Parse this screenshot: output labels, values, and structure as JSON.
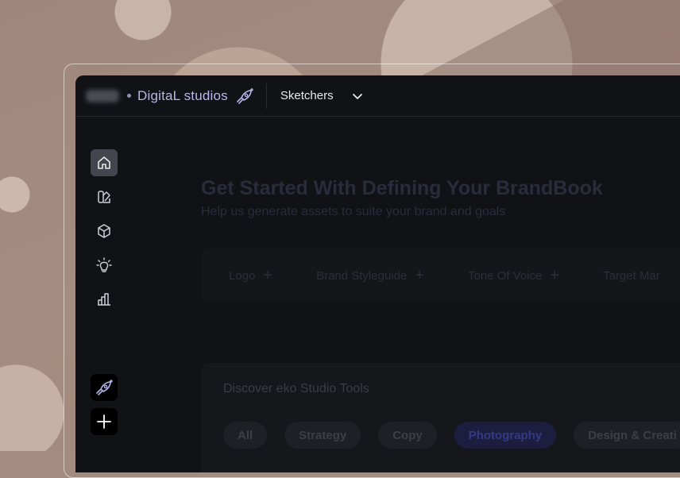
{
  "header": {
    "studio_name": "DigitaL studios",
    "workspace": "Sketchers"
  },
  "sidebar": {
    "items": [
      {
        "icon": "home-icon",
        "active": true
      },
      {
        "icon": "swatches-icon",
        "active": false
      },
      {
        "icon": "cube-icon",
        "active": false
      },
      {
        "icon": "lightbulb-icon",
        "active": false
      },
      {
        "icon": "bar-chart-icon",
        "active": false
      }
    ],
    "bottom": [
      {
        "icon": "rocket-icon"
      },
      {
        "icon": "plus-icon"
      }
    ]
  },
  "main": {
    "headline": "Get Started With Defining Your BrandBook",
    "subline": "Help us generate assets to suite your brand and goals",
    "assets": [
      {
        "label": "Logo"
      },
      {
        "label": "Brand Styleguide"
      },
      {
        "label": "Tone Of Voice"
      },
      {
        "label": "Target Mar"
      }
    ],
    "tools": {
      "title": "Discover eko Studio Tools",
      "chips": [
        "All",
        "Strategy",
        "Copy",
        "Photography",
        "Design & Creati"
      ],
      "selected": "Photography"
    }
  },
  "colors": {
    "accent": "#b7b7ee",
    "app_bg": "#111216",
    "background": "#a48b80"
  }
}
